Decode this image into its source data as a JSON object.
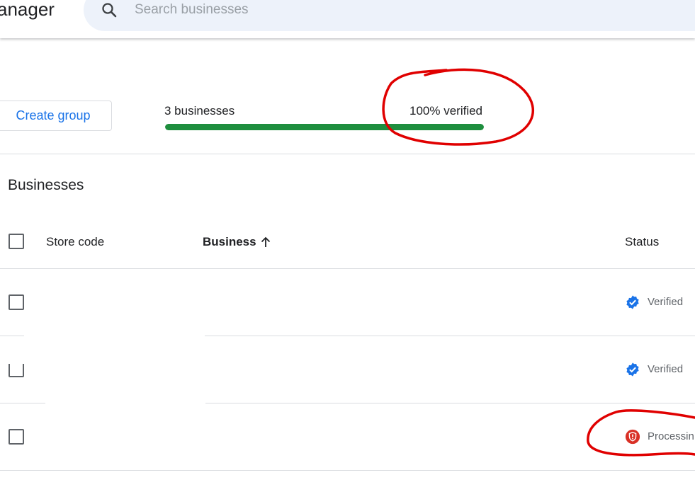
{
  "header": {
    "app_title": "anager",
    "search_placeholder": "Search businesses",
    "search_icon": "search-icon"
  },
  "summary": {
    "create_group_label": "Create group",
    "count_text": "3 businesses",
    "verified_text": "100% verified",
    "verified_fraction": 1.0,
    "progress_color": "#1e8e3e"
  },
  "table": {
    "title": "Businesses",
    "columns": {
      "store_code": "Store code",
      "business": "Business",
      "status": "Status"
    },
    "sort": {
      "column": "business",
      "direction": "ascending",
      "icon": "arrow-up-icon"
    },
    "rows": [
      {
        "status": "Verified",
        "status_icon": "verified-badge-icon",
        "status_color": "#1a73e8"
      },
      {
        "status": "Verified",
        "status_icon": "verified-badge-icon",
        "status_color": "#1a73e8"
      },
      {
        "status": "Processin",
        "status_icon": "alert-shield-icon",
        "status_color": "#d93025"
      }
    ]
  },
  "annotation_color": "#e00000"
}
